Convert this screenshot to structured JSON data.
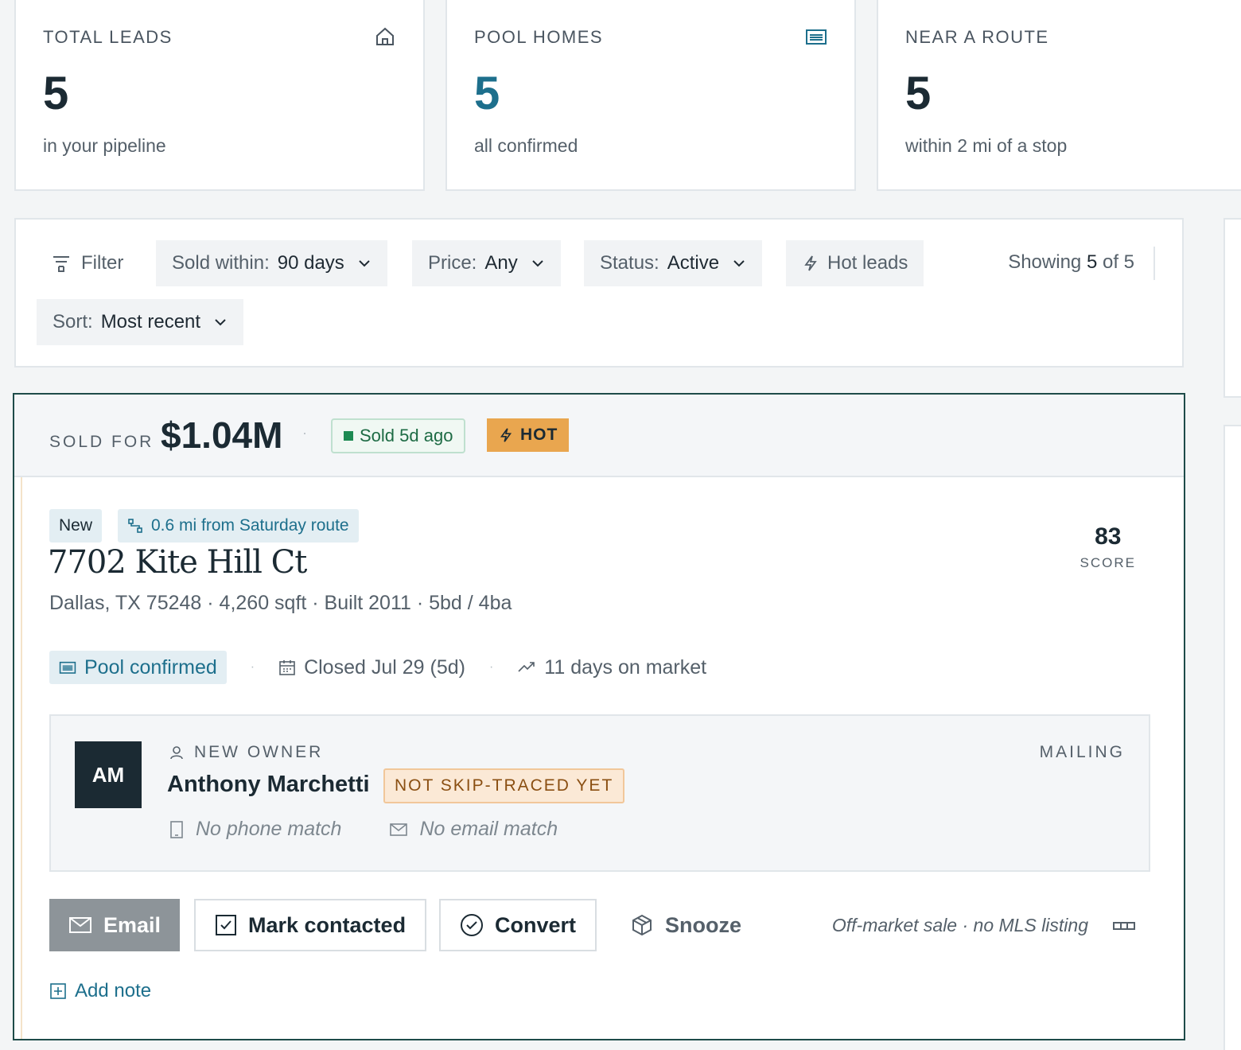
{
  "stats": [
    {
      "label": "TOTAL LEADS",
      "value": "5",
      "sub": "in your pipeline",
      "icon": "home-icon"
    },
    {
      "label": "POOL HOMES",
      "value": "5",
      "sub": "all confirmed",
      "icon": "pool-icon"
    },
    {
      "label": "NEAR A ROUTE",
      "value": "5",
      "sub": "within 2 mi of a stop",
      "icon": "route-icon"
    }
  ],
  "filters": {
    "filter_label": "Filter",
    "sold_within": {
      "label": "Sold within:",
      "value": "90 days"
    },
    "price": {
      "label": "Price:",
      "value": "Any"
    },
    "status": {
      "label": "Status:",
      "value": "Active"
    },
    "hot_leads": "Hot leads",
    "showing_prefix": "Showing",
    "showing_count": "5",
    "showing_suffix": "of 5",
    "sort": {
      "label": "Sort:",
      "value": "Most recent"
    }
  },
  "lead": {
    "sold_label": "SOLD FOR",
    "sold_price": "$1.04M",
    "sold_badge": "Sold 5d ago",
    "hot_badge": "HOT",
    "tag_new": "New",
    "tag_route": "0.6 mi from Saturday route",
    "address": "7702 Kite Hill Ct",
    "meta": "Dallas, TX 75248 · 4,260 sqft · Built 2011 · 5bd / 4ba",
    "score_value": "83",
    "score_label": "SCORE",
    "pool": "Pool confirmed",
    "closed": "Closed Jul 29 (5d)",
    "days_on_market": "11 days on market",
    "owner": {
      "initials": "AM",
      "label": "NEW OWNER",
      "name": "Anthony Marchetti",
      "badge": "NOT SKIP-TRACED YET",
      "phone": "No phone match",
      "email": "No email match",
      "mailing": "MAILING"
    },
    "actions": {
      "email": "Email",
      "mark_contacted": "Mark contacted",
      "convert": "Convert",
      "snooze": "Snooze"
    },
    "offmarket": "Off-market sale · no MLS listing",
    "add_note": "Add note"
  },
  "colors": {
    "accent": "#1d6f8c",
    "hot": "#e9a64f",
    "sold_green": "#1d8a52",
    "lead_border": "#1e4b49",
    "dark": "#1b2a33"
  }
}
